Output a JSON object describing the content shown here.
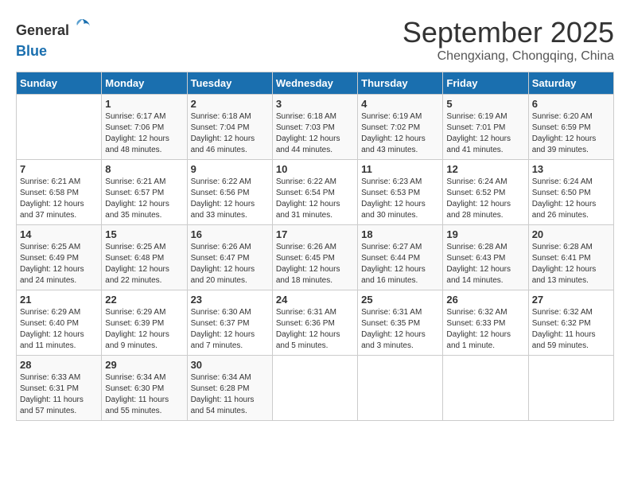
{
  "header": {
    "logo_general": "General",
    "logo_blue": "Blue",
    "month_title": "September 2025",
    "location": "Chengxiang, Chongqing, China"
  },
  "weekdays": [
    "Sunday",
    "Monday",
    "Tuesday",
    "Wednesday",
    "Thursday",
    "Friday",
    "Saturday"
  ],
  "weeks": [
    [
      {
        "day": "",
        "info": ""
      },
      {
        "day": "1",
        "info": "Sunrise: 6:17 AM\nSunset: 7:06 PM\nDaylight: 12 hours\nand 48 minutes."
      },
      {
        "day": "2",
        "info": "Sunrise: 6:18 AM\nSunset: 7:04 PM\nDaylight: 12 hours\nand 46 minutes."
      },
      {
        "day": "3",
        "info": "Sunrise: 6:18 AM\nSunset: 7:03 PM\nDaylight: 12 hours\nand 44 minutes."
      },
      {
        "day": "4",
        "info": "Sunrise: 6:19 AM\nSunset: 7:02 PM\nDaylight: 12 hours\nand 43 minutes."
      },
      {
        "day": "5",
        "info": "Sunrise: 6:19 AM\nSunset: 7:01 PM\nDaylight: 12 hours\nand 41 minutes."
      },
      {
        "day": "6",
        "info": "Sunrise: 6:20 AM\nSunset: 6:59 PM\nDaylight: 12 hours\nand 39 minutes."
      }
    ],
    [
      {
        "day": "7",
        "info": "Sunrise: 6:21 AM\nSunset: 6:58 PM\nDaylight: 12 hours\nand 37 minutes."
      },
      {
        "day": "8",
        "info": "Sunrise: 6:21 AM\nSunset: 6:57 PM\nDaylight: 12 hours\nand 35 minutes."
      },
      {
        "day": "9",
        "info": "Sunrise: 6:22 AM\nSunset: 6:56 PM\nDaylight: 12 hours\nand 33 minutes."
      },
      {
        "day": "10",
        "info": "Sunrise: 6:22 AM\nSunset: 6:54 PM\nDaylight: 12 hours\nand 31 minutes."
      },
      {
        "day": "11",
        "info": "Sunrise: 6:23 AM\nSunset: 6:53 PM\nDaylight: 12 hours\nand 30 minutes."
      },
      {
        "day": "12",
        "info": "Sunrise: 6:24 AM\nSunset: 6:52 PM\nDaylight: 12 hours\nand 28 minutes."
      },
      {
        "day": "13",
        "info": "Sunrise: 6:24 AM\nSunset: 6:50 PM\nDaylight: 12 hours\nand 26 minutes."
      }
    ],
    [
      {
        "day": "14",
        "info": "Sunrise: 6:25 AM\nSunset: 6:49 PM\nDaylight: 12 hours\nand 24 minutes."
      },
      {
        "day": "15",
        "info": "Sunrise: 6:25 AM\nSunset: 6:48 PM\nDaylight: 12 hours\nand 22 minutes."
      },
      {
        "day": "16",
        "info": "Sunrise: 6:26 AM\nSunset: 6:47 PM\nDaylight: 12 hours\nand 20 minutes."
      },
      {
        "day": "17",
        "info": "Sunrise: 6:26 AM\nSunset: 6:45 PM\nDaylight: 12 hours\nand 18 minutes."
      },
      {
        "day": "18",
        "info": "Sunrise: 6:27 AM\nSunset: 6:44 PM\nDaylight: 12 hours\nand 16 minutes."
      },
      {
        "day": "19",
        "info": "Sunrise: 6:28 AM\nSunset: 6:43 PM\nDaylight: 12 hours\nand 14 minutes."
      },
      {
        "day": "20",
        "info": "Sunrise: 6:28 AM\nSunset: 6:41 PM\nDaylight: 12 hours\nand 13 minutes."
      }
    ],
    [
      {
        "day": "21",
        "info": "Sunrise: 6:29 AM\nSunset: 6:40 PM\nDaylight: 12 hours\nand 11 minutes."
      },
      {
        "day": "22",
        "info": "Sunrise: 6:29 AM\nSunset: 6:39 PM\nDaylight: 12 hours\nand 9 minutes."
      },
      {
        "day": "23",
        "info": "Sunrise: 6:30 AM\nSunset: 6:37 PM\nDaylight: 12 hours\nand 7 minutes."
      },
      {
        "day": "24",
        "info": "Sunrise: 6:31 AM\nSunset: 6:36 PM\nDaylight: 12 hours\nand 5 minutes."
      },
      {
        "day": "25",
        "info": "Sunrise: 6:31 AM\nSunset: 6:35 PM\nDaylight: 12 hours\nand 3 minutes."
      },
      {
        "day": "26",
        "info": "Sunrise: 6:32 AM\nSunset: 6:33 PM\nDaylight: 12 hours\nand 1 minute."
      },
      {
        "day": "27",
        "info": "Sunrise: 6:32 AM\nSunset: 6:32 PM\nDaylight: 11 hours\nand 59 minutes."
      }
    ],
    [
      {
        "day": "28",
        "info": "Sunrise: 6:33 AM\nSunset: 6:31 PM\nDaylight: 11 hours\nand 57 minutes."
      },
      {
        "day": "29",
        "info": "Sunrise: 6:34 AM\nSunset: 6:30 PM\nDaylight: 11 hours\nand 55 minutes."
      },
      {
        "day": "30",
        "info": "Sunrise: 6:34 AM\nSunset: 6:28 PM\nDaylight: 11 hours\nand 54 minutes."
      },
      {
        "day": "",
        "info": ""
      },
      {
        "day": "",
        "info": ""
      },
      {
        "day": "",
        "info": ""
      },
      {
        "day": "",
        "info": ""
      }
    ]
  ]
}
